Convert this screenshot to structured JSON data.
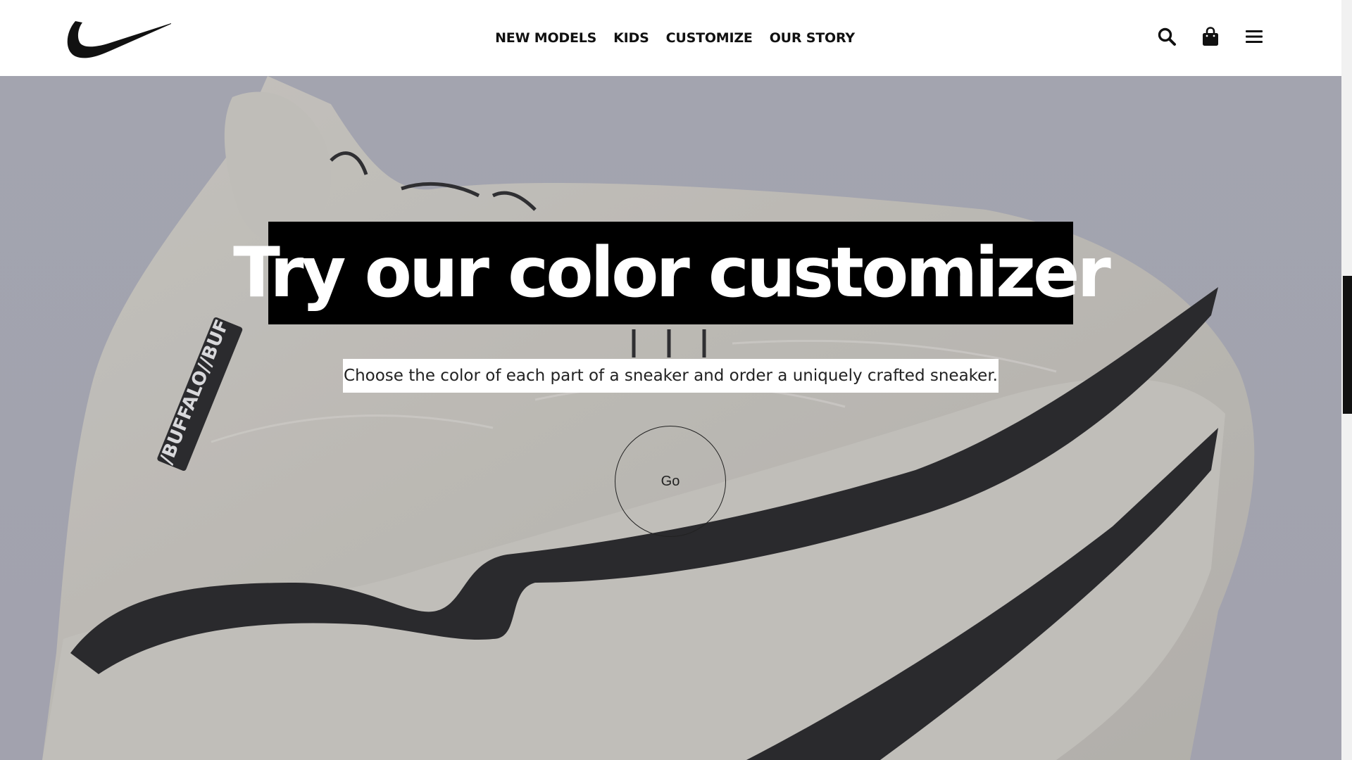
{
  "header": {
    "logo": "nike-swoosh-logo",
    "nav": [
      {
        "label": "NEW MODELS"
      },
      {
        "label": "KIDS"
      },
      {
        "label": "CUSTOMIZE"
      },
      {
        "label": "OUR STORY"
      }
    ],
    "icons": [
      "search-icon",
      "shopping-bag-icon",
      "hamburger-menu-icon"
    ]
  },
  "hero": {
    "title": "Try our color customizer",
    "subtitle": "Choose the color of each part of a sneaker and order a uniquely crafted sneaker.",
    "button_label": "Go",
    "background": "white-sneaker-photo"
  },
  "colors": {
    "header_bg": "#ffffff",
    "title_bg": "#000000",
    "title_text": "#ffffff",
    "hero_overlay": "#a9aab3"
  }
}
